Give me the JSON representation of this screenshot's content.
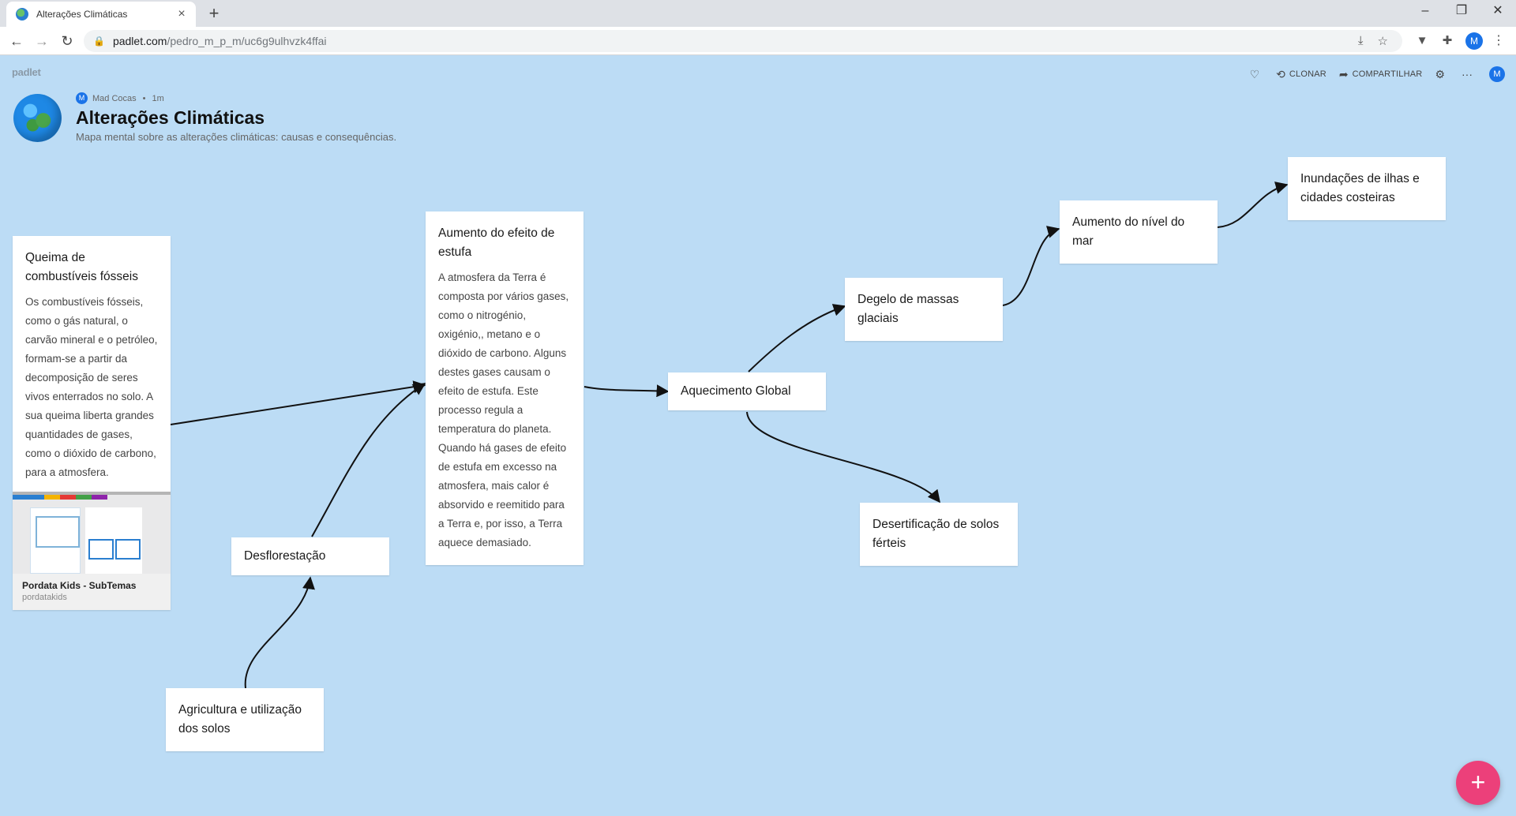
{
  "browser": {
    "tab_title": "Alterações Climáticas",
    "url_host": "padlet.com",
    "url_path": "/pedro_m_p_m/uc6g9ulhvzk4ffai",
    "profile_initial": "M"
  },
  "padlet": {
    "logo": "padlet",
    "actions": {
      "clone": "CLONAR",
      "share": "COMPARTILHAR"
    },
    "user_initial": "M",
    "author": "Mad Cocas",
    "author_initial": "M",
    "time": "1m",
    "title": "Alterações Climáticas",
    "description": "Mapa mental sobre as alterações climáticas: causas e consequências."
  },
  "cards": {
    "queima": {
      "title": "Queima de combustíveis fósseis",
      "body": "Os combustíveis fósseis, como o gás natural, o carvão mineral e o petróleo, formam-se a partir da decomposição de seres vivos enterrados no solo. A sua queima liberta grandes quantidades de gases, como o dióxido de carbono, para a atmosfera.",
      "link_title": "Pordata Kids - SubTemas",
      "link_site": "pordatakids"
    },
    "efeito_estufa": {
      "title": "Aumento do efeito de estufa",
      "body": "A atmosfera da Terra é composta por vários gases, como o nitrogénio, oxigénio,, metano e o dióxido de carbono. Alguns destes gases causam o efeito de estufa. Este processo regula a temperatura do planeta. Quando há gases de efeito de estufa em excesso na atmosfera, mais calor é absorvido e reemitido para a Terra e, por isso, a Terra aquece demasiado."
    },
    "desflorestacao": {
      "title": "Desflorestação"
    },
    "agricultura": {
      "title": "Agricultura e utilização dos solos"
    },
    "aquecimento": {
      "title": "Aquecimento Global"
    },
    "degelo": {
      "title": "Degelo de massas glaciais"
    },
    "nivel_mar": {
      "title": "Aumento do nível do mar"
    },
    "inundacoes": {
      "title": "Inundações de ilhas e cidades costeiras"
    },
    "desertificacao": {
      "title": "Desertificação de solos férteis"
    }
  },
  "fab": "+"
}
